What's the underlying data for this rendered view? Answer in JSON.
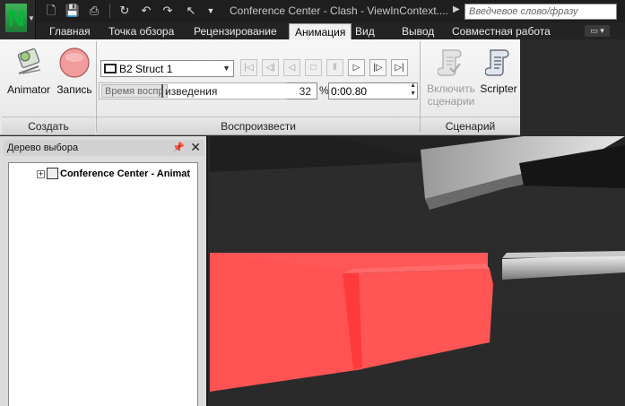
{
  "title_bar": {
    "title": "Conference Center - Clash - ViewInContext....",
    "search_placeholder": "Введчевое слово/фразу"
  },
  "tabs": [
    {
      "label": "Главная"
    },
    {
      "label": "Точка обзора"
    },
    {
      "label": "Рецензирование"
    },
    {
      "label": "Анимация",
      "active": true
    },
    {
      "label": "Вид"
    },
    {
      "label": "Вывод"
    },
    {
      "label": "Совместная работа"
    }
  ],
  "ribbon": {
    "create_panel": {
      "label": "Создать",
      "animator_label": "Animator",
      "record_label": "Запись"
    },
    "playback_panel": {
      "label": "Воспроизвести",
      "animation_select": "B2 Struct 1",
      "time_label": "Время воспр",
      "time_label_rest": "изведения",
      "percent_value": "32",
      "percent_sign": "%",
      "time_value": "0:00.80"
    },
    "script_panel": {
      "label": "Сценарий",
      "enable_label_1": "Включить",
      "enable_label_2": "сценарии",
      "scripter_label": "Scripter"
    }
  },
  "selection_tree": {
    "title": "Дерево выбора",
    "root_item": "Conference Center - Animat",
    "expand_symbol": "+"
  },
  "colors": {
    "accent_red": "#ff5555",
    "active_tab": "#f0f0f0"
  }
}
